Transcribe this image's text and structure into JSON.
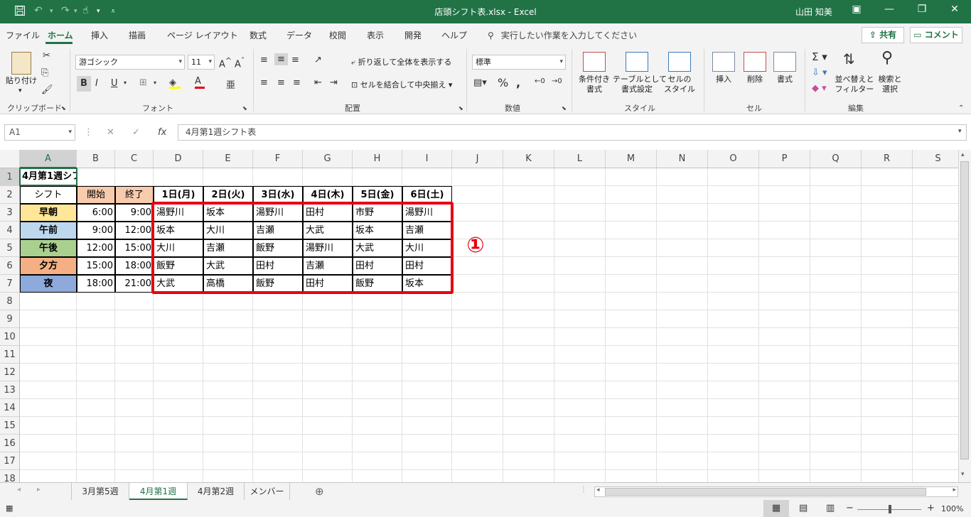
{
  "titlebar": {
    "title": "店頭シフト表.xlsx  -  Excel",
    "user": "山田 知美",
    "save_icon": "save-icon",
    "undo_icon": "undo-icon",
    "redo_icon": "redo-icon",
    "color": "#217346"
  },
  "menu": {
    "items": [
      "ファイル",
      "ホーム",
      "挿入",
      "描画",
      "ページ レイアウト",
      "数式",
      "データ",
      "校閲",
      "表示",
      "開発",
      "ヘルプ"
    ],
    "search": "実行したい作業を入力してください",
    "share": "共有",
    "comment": "コメント"
  },
  "ribbon": {
    "groups": [
      "クリップボード",
      "フォント",
      "配置",
      "数値",
      "スタイル",
      "セル",
      "編集"
    ],
    "paste": "貼り付け",
    "font_name": "游ゴシック",
    "font_size": "11",
    "wrap_text": "折り返して全体を表示する",
    "merge_center": "セルを結合して中央揃え",
    "number_format": "標準",
    "cond_format": [
      "条件付き",
      "書式"
    ],
    "table_format": [
      "テーブルとして",
      "書式設定"
    ],
    "cell_style": [
      "セルの",
      "スタイル"
    ],
    "insert": "挿入",
    "delete": "削除",
    "format": "書式",
    "sort_filter": [
      "並べ替えと",
      "フィルター"
    ],
    "find_select": [
      "検索と",
      "選択"
    ]
  },
  "formula_bar": {
    "name_box": "A1",
    "formula": "4月第1週シフト表"
  },
  "columns": [
    "A",
    "B",
    "C",
    "D",
    "E",
    "F",
    "G",
    "H",
    "I",
    "J",
    "K",
    "L",
    "M",
    "N",
    "O",
    "P",
    "Q",
    "R",
    "S"
  ],
  "rows": [
    "1",
    "2",
    "3",
    "4",
    "5",
    "6",
    "7",
    "8",
    "9",
    "10",
    "11",
    "12",
    "13",
    "14",
    "15",
    "16",
    "17",
    "18"
  ],
  "sheet": {
    "title": "4月第1週シフト表",
    "header": {
      "shift": "シフト",
      "start": "開始",
      "end": "終了",
      "days": [
        "1日(月)",
        "2日(火)",
        "3日(水)",
        "4日(木)",
        "5日(金)",
        "6日(土)"
      ]
    },
    "data_rows": [
      {
        "shift": "早朝",
        "color": "#ffe699",
        "start": "6:00",
        "end": "9:00",
        "names": [
          "湯野川",
          "坂本",
          "湯野川",
          "田村",
          "市野",
          "湯野川"
        ]
      },
      {
        "shift": "午前",
        "color": "#bdd7ee",
        "start": "9:00",
        "end": "12:00",
        "names": [
          "坂本",
          "大川",
          "吉瀬",
          "大武",
          "坂本",
          "吉瀬"
        ]
      },
      {
        "shift": "午後",
        "color": "#a9d08e",
        "start": "12:00",
        "end": "15:00",
        "names": [
          "大川",
          "吉瀬",
          "飯野",
          "湯野川",
          "大武",
          "大川"
        ]
      },
      {
        "shift": "夕方",
        "color": "#f4b084",
        "start": "15:00",
        "end": "18:00",
        "names": [
          "飯野",
          "大武",
          "田村",
          "吉瀬",
          "田村",
          "田村"
        ]
      },
      {
        "shift": "夜",
        "color": "#8ea9db",
        "start": "18:00",
        "end": "21:00",
        "names": [
          "大武",
          "高橋",
          "飯野",
          "田村",
          "飯野",
          "坂本"
        ]
      }
    ],
    "header_fill": "#f8cbad"
  },
  "annotation": {
    "marker": "①",
    "color": "#e60012"
  },
  "sheet_tabs": {
    "items": [
      "3月第5週",
      "4月第1週",
      "4月第2週",
      "メンバー"
    ],
    "active": 1
  },
  "status": {
    "zoom": "100%"
  }
}
